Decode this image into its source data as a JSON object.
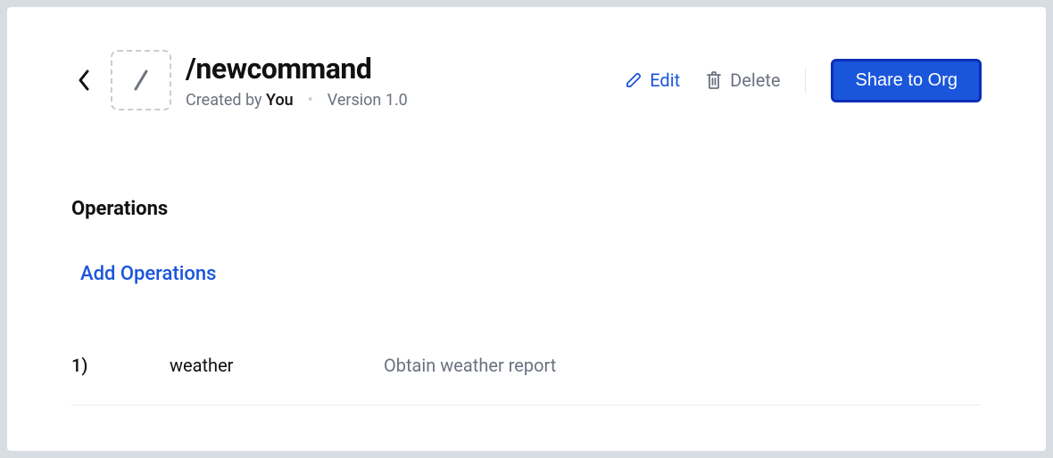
{
  "header": {
    "title": "/newcommand",
    "created_prefix": "Created by ",
    "created_by": "You",
    "version_label": "Version 1.0"
  },
  "actions": {
    "edit_label": "Edit",
    "delete_label": "Delete",
    "share_label": "Share to Org"
  },
  "operations": {
    "section_title": "Operations",
    "add_label": "Add Operations",
    "items": [
      {
        "index": "1)",
        "name": "weather",
        "description": "Obtain weather report"
      }
    ]
  }
}
